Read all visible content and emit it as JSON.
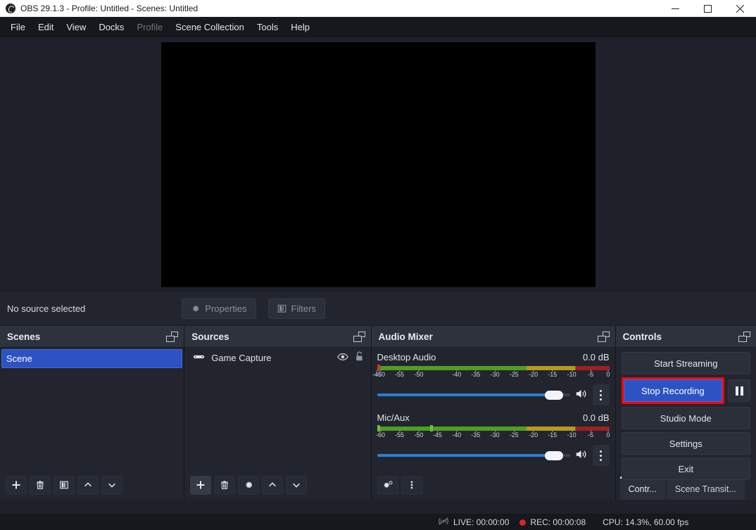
{
  "window": {
    "title": "OBS 29.1.3 - Profile: Untitled - Scenes: Untitled",
    "logo_icon": "obs-logo-icon",
    "minimize_icon": "minimize-icon",
    "maximize_icon": "maximize-icon",
    "close_icon": "close-icon"
  },
  "menubar": {
    "items": [
      {
        "label": "File",
        "disabled": false
      },
      {
        "label": "Edit",
        "disabled": false
      },
      {
        "label": "View",
        "disabled": false
      },
      {
        "label": "Docks",
        "disabled": false
      },
      {
        "label": "Profile",
        "disabled": true
      },
      {
        "label": "Scene Collection",
        "disabled": false
      },
      {
        "label": "Tools",
        "disabled": false
      },
      {
        "label": "Help",
        "disabled": false
      }
    ]
  },
  "source_bar": {
    "status": "No source selected",
    "properties_label": "Properties",
    "properties_icon": "gear-icon",
    "filters_label": "Filters",
    "filters_icon": "filters-icon"
  },
  "scenes": {
    "title": "Scenes",
    "popout_icon": "popout-icon",
    "items": [
      {
        "label": "Scene",
        "selected": true
      }
    ],
    "tools": [
      {
        "name": "add-scene-button",
        "icon": "plus-icon"
      },
      {
        "name": "remove-scene-button",
        "icon": "trash-icon"
      },
      {
        "name": "scene-filters-button",
        "icon": "filters-icon"
      },
      {
        "name": "move-scene-up-button",
        "icon": "chevron-up-icon"
      },
      {
        "name": "move-scene-down-button",
        "icon": "chevron-down-icon"
      }
    ]
  },
  "sources": {
    "title": "Sources",
    "popout_icon": "popout-icon",
    "items": [
      {
        "label": "Game Capture",
        "type_icon": "gamepad-icon",
        "visible_icon": "eye-icon",
        "lock_icon": "unlock-icon"
      }
    ],
    "tools": [
      {
        "name": "add-source-button",
        "icon": "plus-icon"
      },
      {
        "name": "remove-source-button",
        "icon": "trash-icon"
      },
      {
        "name": "source-properties-button",
        "icon": "gear-icon"
      },
      {
        "name": "move-source-up-button",
        "icon": "chevron-up-icon"
      },
      {
        "name": "move-source-down-button",
        "icon": "chevron-down-icon"
      }
    ]
  },
  "mixer": {
    "title": "Audio Mixer",
    "popout_icon": "popout-icon",
    "tick_labels": [
      "-60",
      "-55",
      "-50",
      "-45",
      "-40",
      "-35",
      "-30",
      "-25",
      "-20",
      "-15",
      "-10",
      "-5",
      "0"
    ],
    "channels": [
      {
        "name": "Desktop Audio",
        "db": "0.0 dB",
        "volume_percent": 100,
        "peak_position_percent": 0,
        "peak_color": "#c0392b",
        "mute_icon": "speaker-icon",
        "menu_icon": "kebab-icon"
      },
      {
        "name": "Mic/Aux",
        "db": "0.0 dB",
        "volume_percent": 100,
        "peak_position_percent": 23,
        "peak_color": "#6abf3f",
        "mute_icon": "speaker-icon",
        "menu_icon": "kebab-icon"
      }
    ],
    "tools": [
      {
        "name": "audio-settings-button",
        "icon": "gears-icon"
      },
      {
        "name": "mixer-menu-button",
        "icon": "kebab-icon"
      }
    ]
  },
  "controls": {
    "title": "Controls",
    "popout_icon": "popout-icon",
    "start_streaming": "Start Streaming",
    "stop_recording": "Stop Recording",
    "pause_icon": "pause-icon",
    "studio_mode": "Studio Mode",
    "settings": "Settings",
    "exit": "Exit",
    "highlight_color": "#ff0000",
    "active_button_color": "#2c52c4",
    "tabs": [
      {
        "label": "Contr...",
        "active": true
      },
      {
        "label": "Scene Transit...",
        "active": false
      }
    ]
  },
  "statusbar": {
    "stream_icon": "stream-inactive-icon",
    "live_label": "LIVE: 00:00:00",
    "rec_icon": "record-dot-icon",
    "rec_label": "REC: 00:00:08",
    "performance": "CPU: 14.3%, 60.00 fps"
  }
}
